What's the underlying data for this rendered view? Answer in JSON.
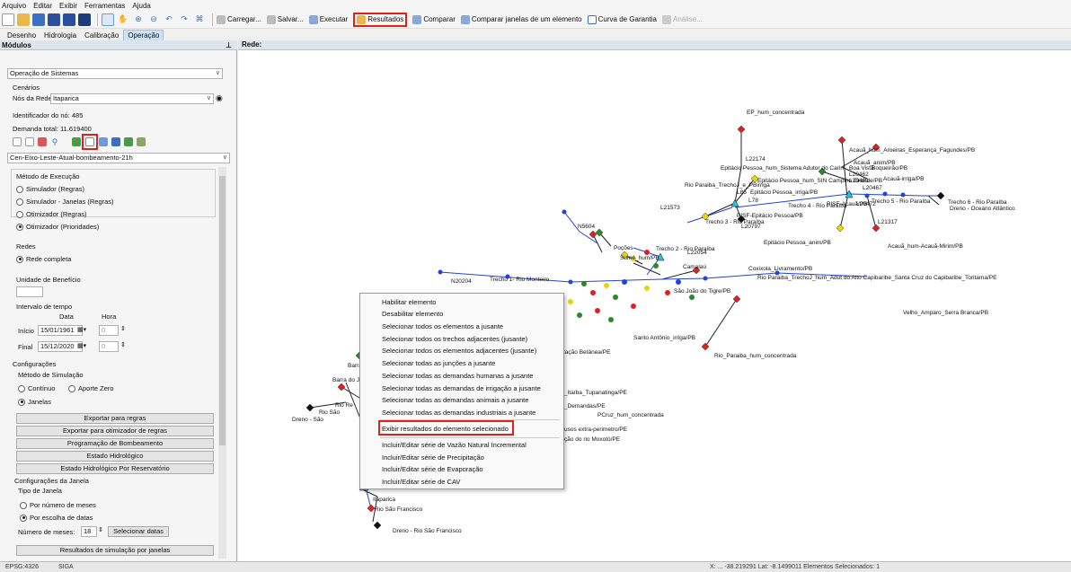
{
  "menubar": [
    "Arquivo",
    "Editar",
    "Exibir",
    "Ferramentas",
    "Ajuda"
  ],
  "toolbar": {
    "carregar": "Carregar...",
    "salvar": "Salvar...",
    "executar": "Executar",
    "resultados": "Resultados",
    "comparar": "Comparar",
    "comparar_janelas": "Comparar janelas de um elemento",
    "curva": "Curva de Garantia",
    "analise": "Análise..."
  },
  "tabs": [
    "Desenho",
    "Hidrologia",
    "Calibração",
    "Operação"
  ],
  "left_header": "Módulos",
  "pin_icon": "pin-icon",
  "right_header": "Rede:",
  "left": {
    "module": "Operação de Sistemas",
    "cenarios": "Cenários",
    "nos_label": "Nós da Rede",
    "nos_value": "Itaparica",
    "id_label": "Identificador do nó: 485",
    "demanda_label": "Demanda total: 11.619400",
    "scenario": "Cen-Eixo-Leste-Atual-bombeamento-21h",
    "metodo": "Método de Execução",
    "metodo_opts": [
      "Simulador (Regras)",
      "Simulador - Janelas (Regras)",
      "Otimizador (Regras)",
      "Otimizador (Prioridades)"
    ],
    "redes": "Redes",
    "rede_completa": "Rede completa",
    "unidade": "Unidade de Benefício",
    "intervalo": "Intervalo de tempo",
    "data": "Data",
    "hora": "Hora",
    "inicio": "Início",
    "inicio_date": "15/01/1961",
    "final": "Final",
    "final_date": "15/12/2020",
    "hora_val": "0",
    "config": "Configurações",
    "metodo_sim": "Método de Simulação",
    "continuo": "Contínuo",
    "aporte": "Aporte Zero",
    "janelas": "Janelas",
    "buttons": [
      "Exportar para regras",
      "Exportar para otimizador de regras",
      "Programação de Bombeamento",
      "Estado Hidrológico",
      "Estado Hidrológico Por Reservatório"
    ],
    "config_janela": "Configurações da Janela",
    "tipo_janela": "Tipo de Janela",
    "por_numero": "Por número de meses",
    "por_escolha": "Por escolha de datas",
    "num_meses": "Número de meses:",
    "num_meses_val": "18",
    "selecionar": "Selecionar datas",
    "resultados_btn": "Resultados de simulação por janelas"
  },
  "context_menu": [
    "Habilitar elemento",
    "Desabilitar elemento",
    "Selecionar todos os elementos a jusante",
    "Selecionar todos os trechos adjacentes (jusante)",
    "Selecionar todos os elementos adjacentes (jusante)",
    "Selecionar todas as junções a jusante",
    "Selecionar todas as demandas humanas a jusante",
    "Selecionar todas as demandas de irrigação a jusante",
    "Selecionar todas as demandas animais a jusante",
    "Selecionar todas as demandas industriais a jusante",
    "Exibir resultados do elemento selecionado",
    "Incluir/Editar série de Vazão Natural Incremental",
    "Incluir/Editar série de Precipitação",
    "Incluir/Editar série de Evaporação",
    "Incluir/Editar série de CAV"
  ],
  "network_labels": {
    "ep_hum": "EP_hum_concentrada",
    "l22174": "L22174",
    "acaua_aroeiras": "Acauã_hum_Aroeiras_Esperança_Fagundes/PB",
    "acaua_anim": "Acauã_anim/PB",
    "epitacio_sistema": "Epitácio Pessoa_hum_Sistema Adutor do Cariri",
    "boa_vista": "Boa Vista",
    "boqueirao": "Boqueirão/PB",
    "l20462": "L20462",
    "l20463": "L20463",
    "acaua_irriga": "Acauã-irriga/PB",
    "epitacio_sin": "Epitácio Pessoa_hum_SIN Campina Grande/PB",
    "l20467": "L20467",
    "rio_paraiba_trecho": "Rio Paraiba_TrechoJ_e_PBirriga",
    "l85": "L85",
    "epitacio_irriga": "Epitácio Pessoa_irriga/PB",
    "l78": "L78",
    "l21573": "L21573",
    "trecho4": "Trecho 4 - Rio Paraíba",
    "pisf_acaua": "PISF-Acauã/PB",
    "l20472": "L20472",
    "trecho5": "Trecho 5 - Rio Paraíba",
    "trecho6": "Trecho 6 - Rio Paraíba",
    "dreno_oceano": "Dreno - Oceano Atlântico",
    "pisf_epitacio": "PISF-Epitácio Pessoa/PB",
    "trecho3": "Trecho 3 - Rio Paraíba",
    "l21317": "L21317",
    "l20797": "L20797",
    "n5604": "N5604",
    "epitacio_anim": "Epitácio Pessoa_anim/PB",
    "acaua_hum_mirim": "Acauã_hum-Acauã-Mirim/PB",
    "trecho2": "Trecho 2 - Rio Paraíba",
    "l22054": "L22054",
    "sume_hum": "Sumé_hum/PB",
    "pocoes": "Poções",
    "camalau": "Camalaú",
    "coxixola": "Coxixola_Livramento/PB",
    "rio_paraiba_hum_adut": "Rio Paraiba_TrechoJ_hum_Adut do Alto Capibaribe_Santa Cruz do Capibaribe_Toritama/PE",
    "n20204": "N20204",
    "trecho1": "Trecho 1- Rio Monteiro",
    "sao_joao_tigre": "São João do Tigre/PB",
    "santo_antonio_irriga": "Santo Antônio_irriga/PB",
    "rio_paraiba_hum_conc": "Rio_Paraiba_hum_concentrada",
    "serra_branca": "Velho_Amparo_Serra Branca/PB",
    "betania": "tação Betânea/PE",
    "barra_j": "Barra do J",
    "barra": "Barra",
    "rio_reg": "Rio Re",
    "itaiba": "_Itaíba_Tupanatinga/PE",
    "demandas": "_Demandas/PE",
    "pcruz": "PCruz_hum_concentrada",
    "extra_perimetro": "usos extra-perimetro/PE",
    "moxoto": "ção do rio Moxotó/PE",
    "dreno_sao": "Dreno - São",
    "rio_sao": "Rio São",
    "itaparica": "Itaparica",
    "rio_sao_francisco": "Rio São Francisco",
    "dreno_sao_francisco": "Dreno - Rio São Francisco"
  },
  "status": {
    "left": "EPSG:4326",
    "mid": "SIGA",
    "right": "X: ...  -38.219291  Lat: -8.1499011  Elementos Selecionados: 1"
  }
}
